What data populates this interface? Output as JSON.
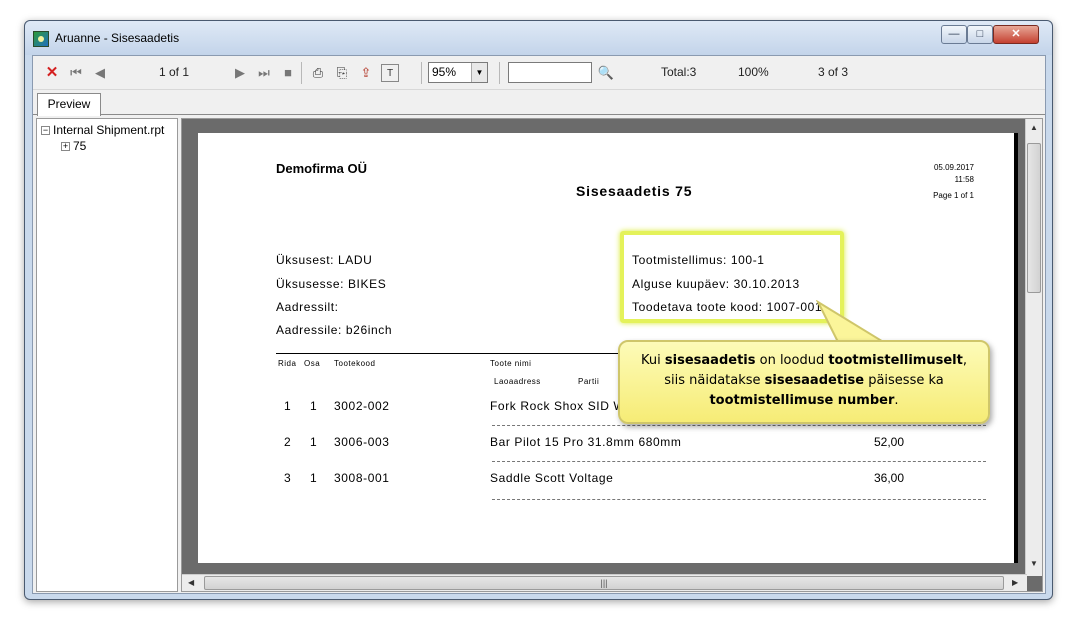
{
  "window": {
    "title": "Aruanne - Sisesaadetis",
    "min_label": "—",
    "max_label": "□",
    "close_label": "✕"
  },
  "toolbar": {
    "page_indicator": "1 of 1",
    "zoom_value": "95%",
    "total": "Total:3",
    "percent": "100%",
    "count": "3 of 3"
  },
  "tab": {
    "label": "Preview"
  },
  "tree": {
    "root": "Internal Shipment.rpt",
    "child": "75"
  },
  "report": {
    "company": "Demofirma OÜ",
    "title": "Sisesaadetis  75",
    "date": "05.09.2017",
    "time": "11:58",
    "page": "Page 1 of 1",
    "from": "Üksusest: LADU",
    "to": "Üksusesse: BIKES",
    "address_from": "Aadressilt:",
    "address_to": "Aadressile: b26inch",
    "production_order": "Tootmistellimus: 100-1",
    "start_date": "Alguse kuupäev: 30.10.2013",
    "product_code": "Toodetava toote kood: 1007-001",
    "columns": {
      "row": "Rida",
      "part": "Osa",
      "code": "Tootekood",
      "name": "Toote nimi",
      "location": "Laoaadress",
      "batch": "Partii"
    },
    "rows": [
      {
        "row": "1",
        "part": "1",
        "code": "3002-002",
        "name": "Fork Rock Shox SID W",
        "qty": ""
      },
      {
        "row": "2",
        "part": "1",
        "code": "3006-003",
        "name": "Bar Pilot 15 Pro 31.8mm 680mm",
        "qty": "52,00"
      },
      {
        "row": "3",
        "part": "1",
        "code": "3008-001",
        "name": "Saddle Scott Voltage",
        "qty": "36,00"
      }
    ]
  },
  "callout": {
    "p1": "Kui ",
    "b1": "sisesaadetis",
    "p2": " on loodud ",
    "b2": "tootmistellimuselt",
    "p3": ",",
    "p4": "siis näidatakse ",
    "b3": "sisesaadetise",
    "p5": " päisesse ka",
    "b4": "tootmistellimuse number",
    "p6": "."
  },
  "colors": {
    "highlight": "#e4f25a",
    "callout_fill": "#fbf59a",
    "close_button": "#c44030"
  }
}
